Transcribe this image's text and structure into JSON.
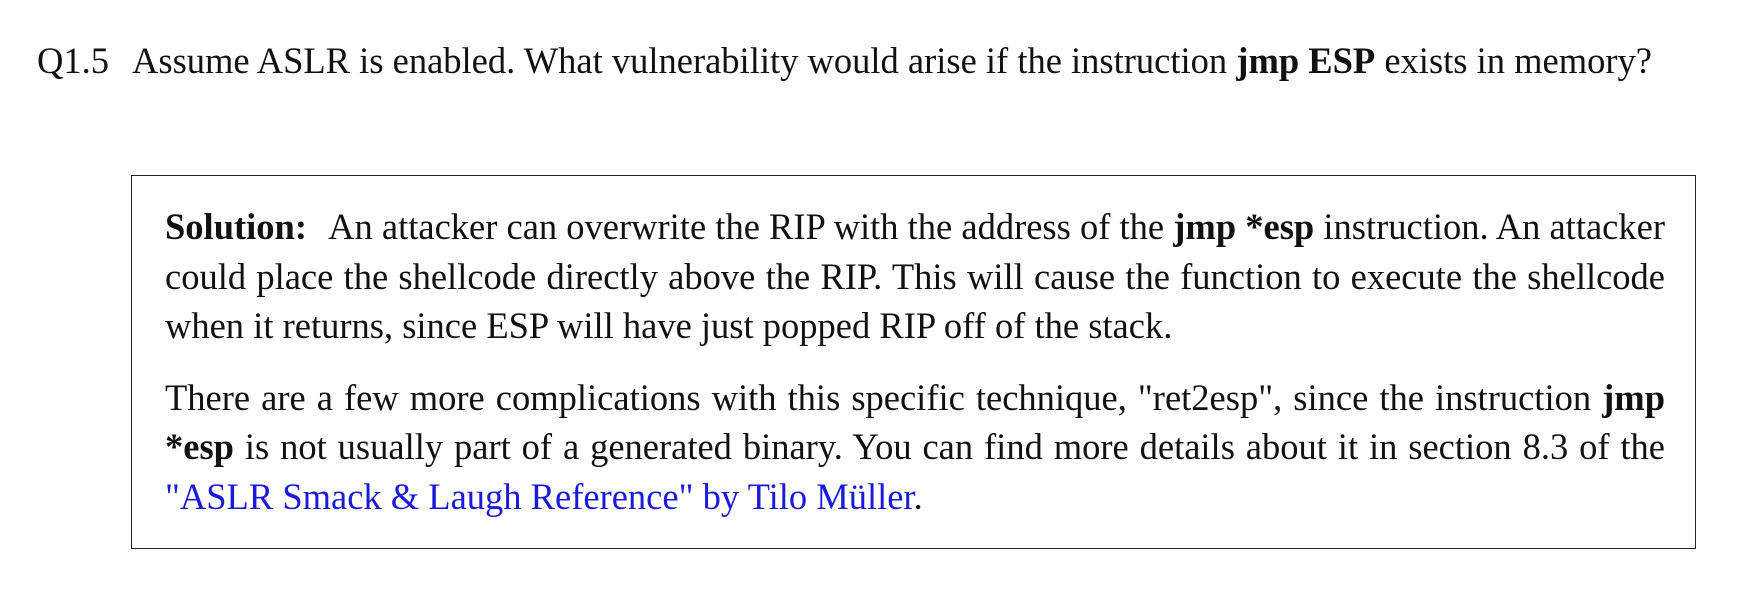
{
  "question": {
    "number": "Q1.5",
    "text_before": "Assume ASLR is enabled. What vulnerability would arise if the instruction",
    "bold_term": "jmp ESP",
    "text_after": "exists in memory?"
  },
  "solution": {
    "label": "Solution:",
    "p1_a": "An attacker can overwrite the RIP with the address of the",
    "p1_bold": "jmp *esp",
    "p1_b": "instruction. An attacker could place the shellcode directly above the RIP. This will cause the function to execute the shellcode when it returns, since ESP will have just popped RIP off of the stack.",
    "p2_a": "There are a few more complications with this specific technique, \"ret2esp\", since the instruction",
    "p2_bold": "jmp *esp",
    "p2_b": "is not usually part of a generated binary. You can find more details about it in section 8.3 of the",
    "link_text": "\"ASLR Smack & Laugh Reference\" by Tilo Müller",
    "p2_end": "."
  },
  "colors": {
    "link": "#1a1adc",
    "border": "#222222",
    "text": "#111111"
  }
}
